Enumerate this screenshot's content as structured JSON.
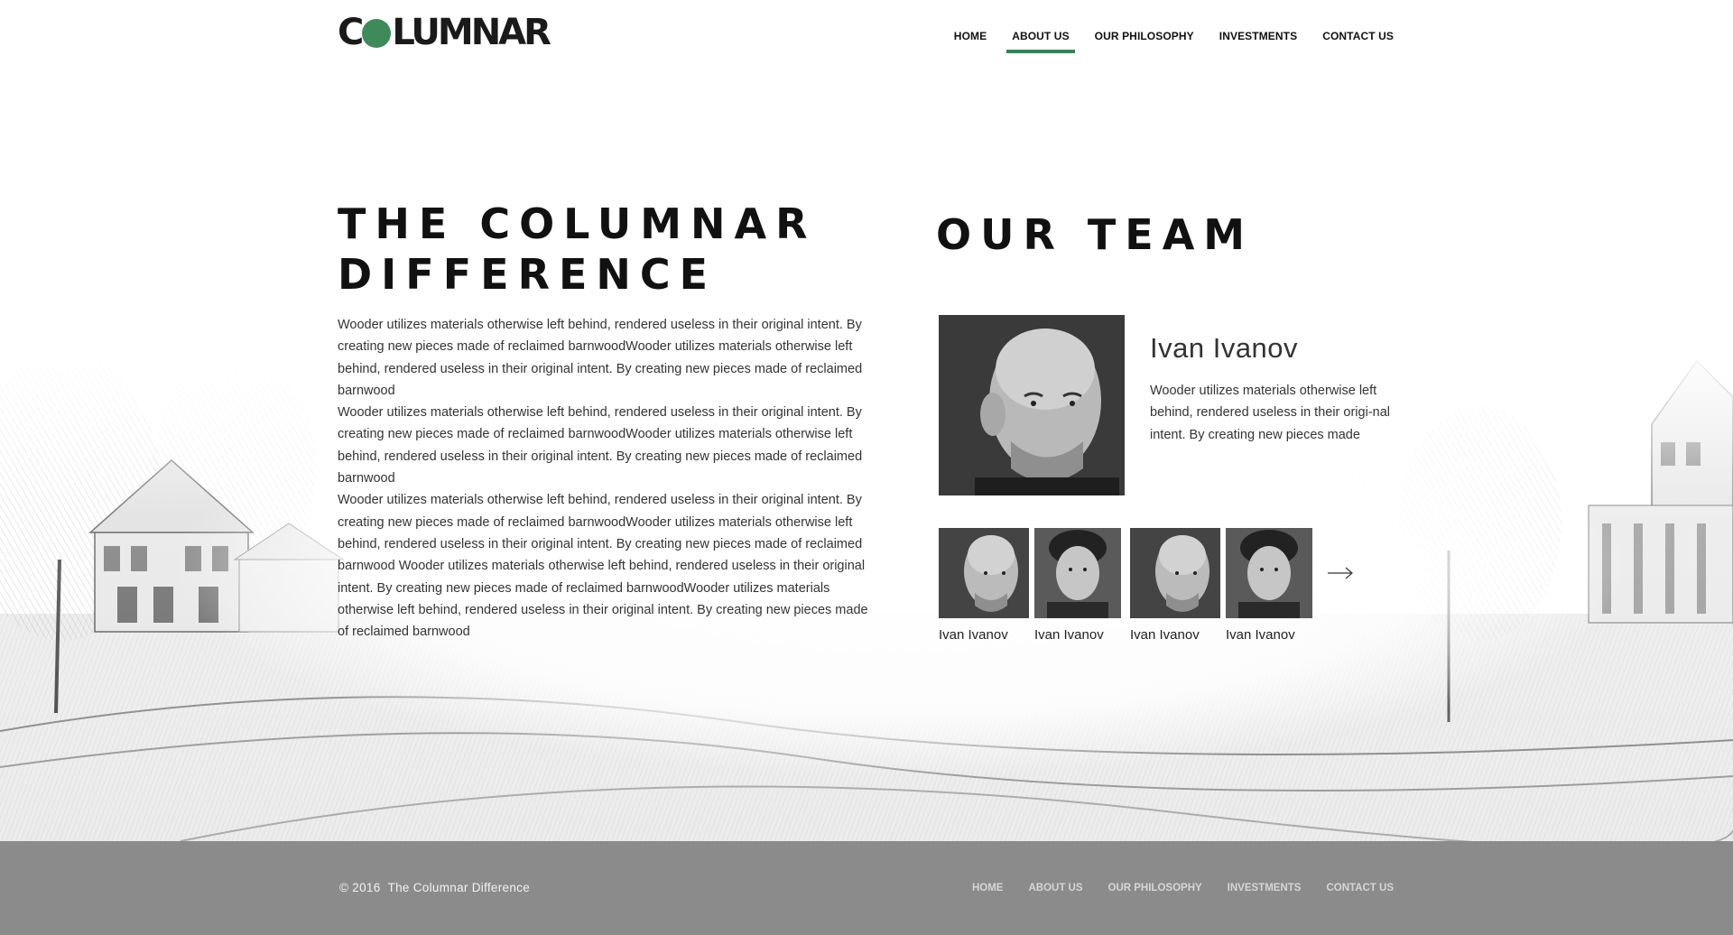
{
  "brand": {
    "logo_text_before": "C",
    "logo_text_after": "LUMNAR",
    "logo_full": "COLUMNAR",
    "accent_color": "#3c7f55"
  },
  "nav": {
    "items": [
      {
        "label": "HOME",
        "active": false
      },
      {
        "label": "ABOUT US",
        "active": true
      },
      {
        "label": "OUR PHILOSOPHY",
        "active": false
      },
      {
        "label": "INVESTMENTS",
        "active": false
      },
      {
        "label": "CONTACT US",
        "active": false
      }
    ]
  },
  "difference": {
    "title_line1": "THE COLUMNAR",
    "title_line2": "DIFFERENCE",
    "paragraphs": [
      "Wooder utilizes materials otherwise left behind, rendered useless in their original intent. By creating new pieces made of reclaimed barnwoodWooder utilizes materials otherwise left behind, rendered useless in their original intent. By creating new pieces made of reclaimed barnwood",
      "Wooder utilizes materials otherwise left behind, rendered useless in their original intent. By creating new pieces made of reclaimed barnwoodWooder utilizes materials otherwise left behind, rendered useless in their original intent. By creating new pieces made of reclaimed barnwood",
      "Wooder utilizes materials otherwise left behind, rendered useless in their original intent. By creating new pieces made of reclaimed barnwoodWooder utilizes materials otherwise left behind, rendered useless in their original intent. By creating new pieces made of reclaimed barnwood Wooder utilizes materials otherwise left behind, rendered useless in their original intent. By creating new pieces made of reclaimed barnwoodWooder utilizes materials otherwise left behind, rendered useless in their original intent. By creating new pieces made of reclaimed barnwood"
    ]
  },
  "team": {
    "title": "OUR TEAM",
    "featured": {
      "name": "Ivan Ivanov",
      "description": "Wooder utilizes materials otherwise left behind, rendered useless in their origi-nal intent. By creating new pieces made"
    },
    "members": [
      {
        "name": "Ivan Ivanov",
        "photo": "older-man-portrait"
      },
      {
        "name": "Ivan Ivanov",
        "photo": "young-man-portrait"
      },
      {
        "name": "Ivan Ivanov",
        "photo": "older-man-portrait"
      },
      {
        "name": "Ivan Ivanov",
        "photo": "young-man-portrait"
      }
    ],
    "next_icon": "arrow-right-icon"
  },
  "footer": {
    "year": "© 2016",
    "site_name": "The Columnar Difference",
    "nav": [
      "HOME",
      "ABOUT US",
      "OUR PHILOSOPHY",
      "INVESTMENTS",
      "CONTACT US"
    ]
  }
}
